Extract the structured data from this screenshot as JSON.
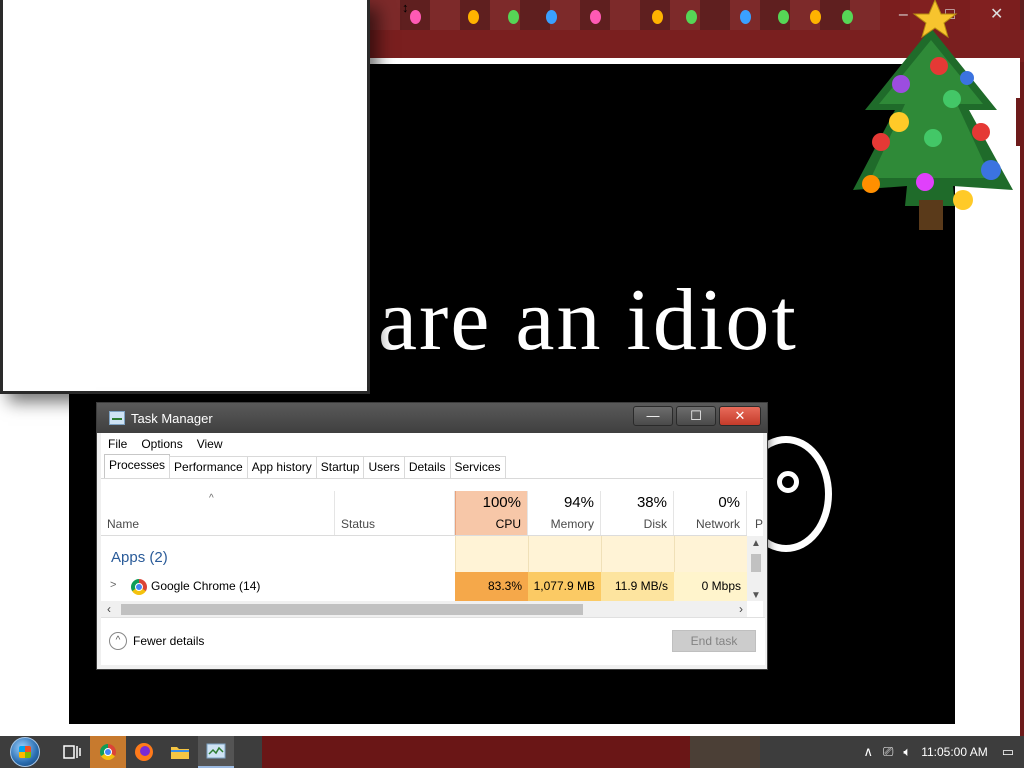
{
  "background": {
    "page_text": "are an idiot",
    "window_controls": {
      "minimize": "–",
      "maximize": "□",
      "close": "✕"
    }
  },
  "task_manager": {
    "title": "Task Manager",
    "window_controls": {
      "minimize": "—",
      "maximize": "☐",
      "close": "✕"
    },
    "menu": [
      "File",
      "Options",
      "View"
    ],
    "tabs": [
      "Processes",
      "Performance",
      "App history",
      "Startup",
      "Users",
      "Details",
      "Services"
    ],
    "active_tab": "Processes",
    "columns": {
      "name": "Name",
      "status": "Status",
      "cpu": {
        "label": "CPU",
        "pct": "100%"
      },
      "memory": {
        "label": "Memory",
        "pct": "94%"
      },
      "disk": {
        "label": "Disk",
        "pct": "38%"
      },
      "network": {
        "label": "Network",
        "pct": "0%"
      },
      "power_partial": "P"
    },
    "groups": {
      "apps_label": "Apps (2)"
    },
    "rows": [
      {
        "name": "Google Chrome (14)",
        "cpu": "83.3%",
        "memory": "1,077.9 MB",
        "disk": "11.9 MB/s",
        "network": "0 Mbps"
      }
    ],
    "footer": {
      "fewer_details": "Fewer details",
      "end_task": "End task"
    }
  },
  "taskbar": {
    "clock": "11:05:00 AM",
    "icons": [
      "start-orb",
      "task-view-icon",
      "chrome-icon",
      "firefox-icon",
      "file-explorer-icon",
      "task-manager-icon"
    ]
  },
  "colors": {
    "cpu_header_bg": "#f7c7a8",
    "cpu_cell_bg": "#f5a84a",
    "memory_cell_bg": "#fbca64",
    "disk_cell_bg": "#fde49f",
    "network_cell_bg": "#fff4cc",
    "apps_label": "#2a5b99"
  }
}
